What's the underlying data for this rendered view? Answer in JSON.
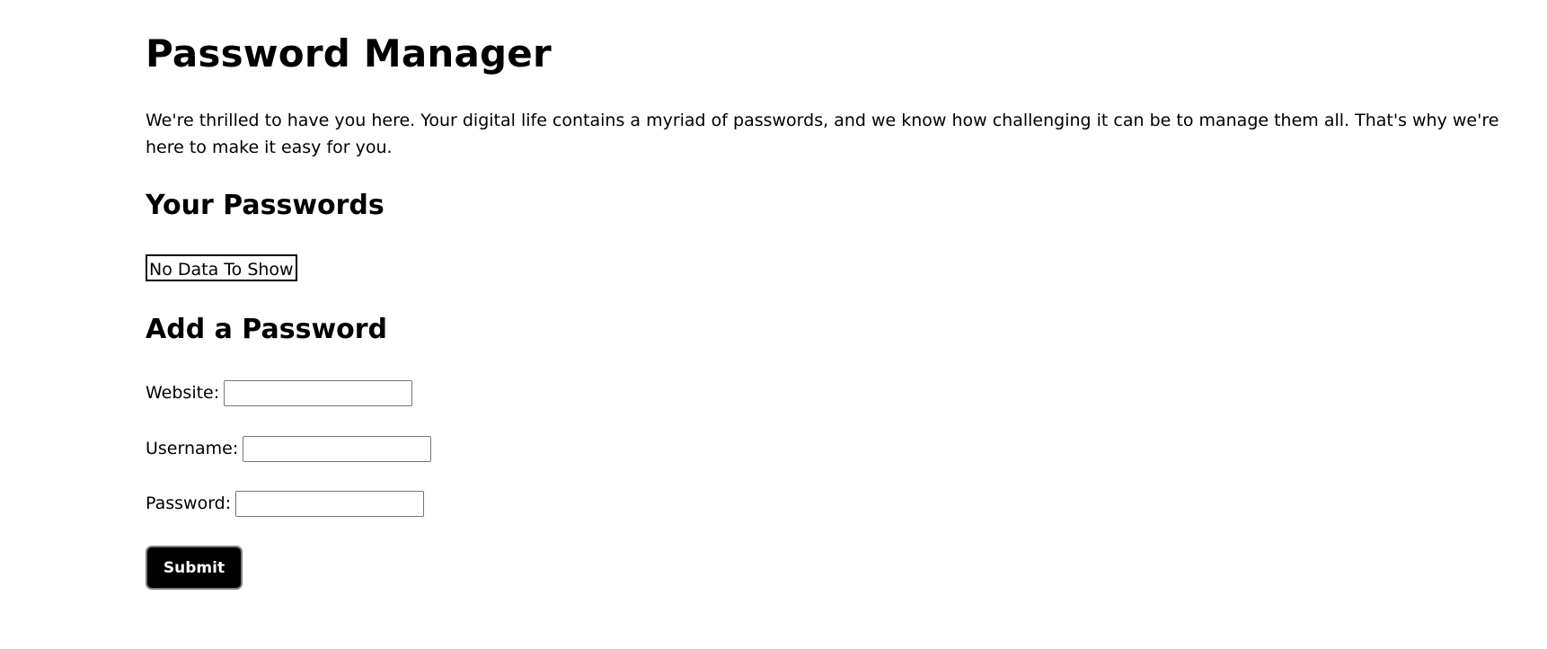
{
  "header": {
    "title": "Password Manager",
    "intro": "We're thrilled to have you here. Your digital life contains a myriad of passwords, and we know how challenging it can be to manage them all. That's why we're here to make it easy for you."
  },
  "passwords_section": {
    "heading": "Your Passwords",
    "empty_message": "No Data To Show"
  },
  "add_section": {
    "heading": "Add a Password",
    "website_label": "Website:",
    "website_value": "",
    "username_label": "Username:",
    "username_value": "",
    "password_label": "Password:",
    "password_value": "",
    "submit_label": "Submit"
  },
  "colors": {
    "text": "#000000",
    "background": "#ffffff",
    "button_bg": "#000000",
    "button_text": "#ffffff",
    "button_border": "#808080"
  }
}
